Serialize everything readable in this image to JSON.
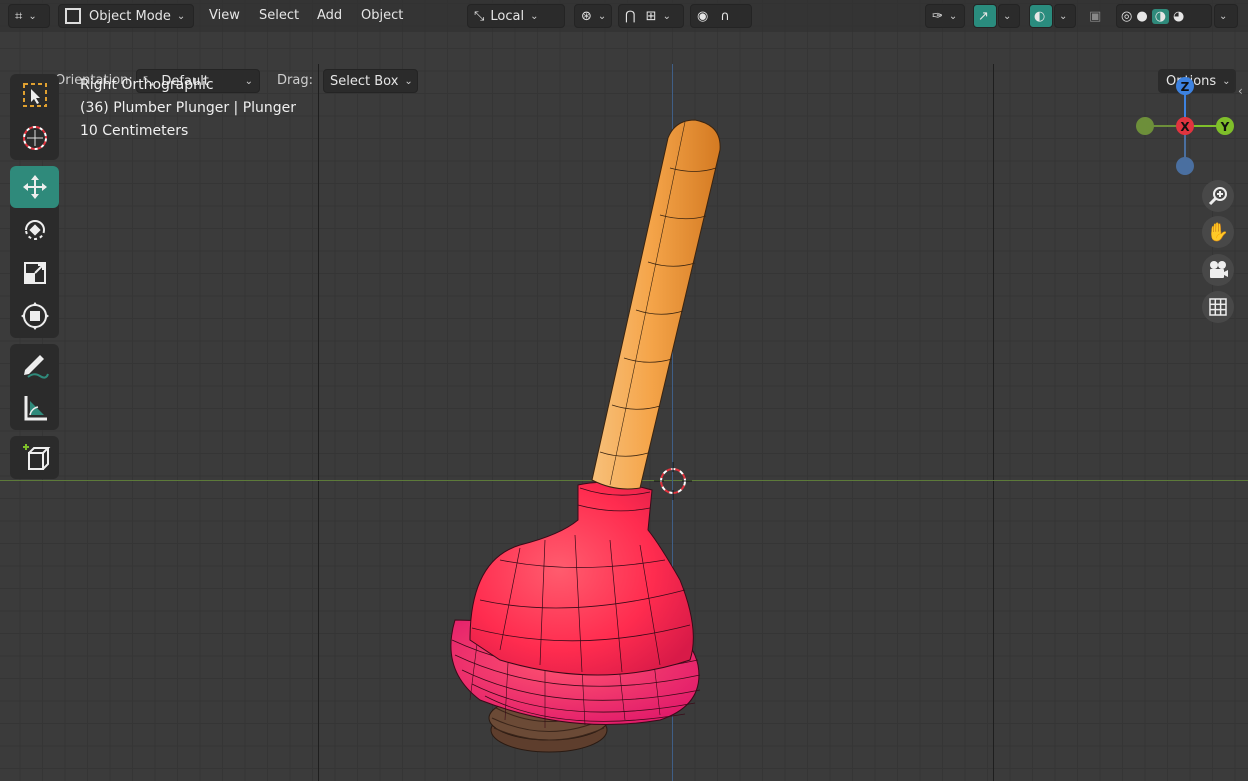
{
  "header": {
    "editor_type_icon": "editor-type-icon",
    "mode": "Object Mode",
    "menu": [
      "View",
      "Select",
      "Add",
      "Object"
    ],
    "transform_space": "Local"
  },
  "tool_header": {
    "orientation_label": "Orientation:",
    "orientation_value": "Default",
    "drag_label": "Drag:",
    "drag_value": "Select Box",
    "options_label": "Options"
  },
  "viewport_info": {
    "view_name": "Right Orthographic",
    "object_info": "(36) Plumber Plunger | Plunger",
    "scale": "10 Centimeters"
  },
  "toolbar": {
    "tools": [
      "select-box",
      "cursor",
      "move",
      "rotate",
      "scale",
      "transform",
      "annotate",
      "measure",
      "add-cube"
    ],
    "active_tool": "move"
  },
  "gizmo": {
    "axes": [
      "Z",
      "X",
      "Y"
    ],
    "colors": {
      "x": "#e0343f",
      "y": "#7fbf2a",
      "z": "#3d82e0",
      "neg_y": "#6d8f3a",
      "neg_z": "#4a6fa0"
    }
  },
  "colors": {
    "accent": "#2f8a7b",
    "handle": "#f5a54a",
    "cup": "#ff2c4f",
    "base": "#6b4a36"
  }
}
